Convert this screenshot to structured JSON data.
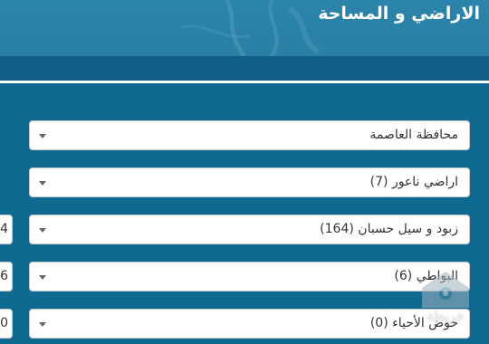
{
  "header": {
    "title": "الاراضي و المساحة"
  },
  "selects": [
    {
      "value": "محافظة العاصمة"
    },
    {
      "value": "اراضي ناعور (7)"
    },
    {
      "value": "زبود و سيل حسبان (164)"
    },
    {
      "value": "البواطي (6)"
    },
    {
      "value": "حوض الأحياء (0)"
    }
  ],
  "side_stubs": [
    "4",
    "6",
    "0"
  ],
  "watermark": {
    "label": "خريطة"
  },
  "colors": {
    "header_bg": "#2b84ab",
    "content_bg": "#0f6991",
    "divider": "#ffffff"
  }
}
